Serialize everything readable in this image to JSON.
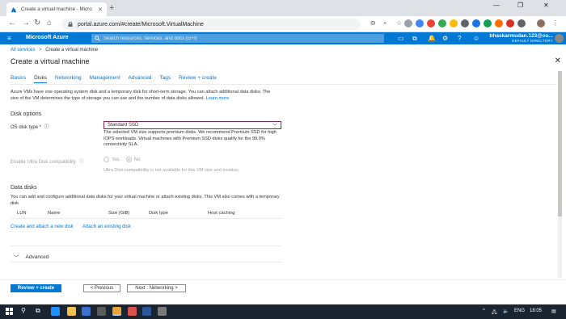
{
  "browser": {
    "tab_title": "Create a virtual machine - Micro",
    "new_tab": "+",
    "url": "portal.azure.com/#create/Microsoft.VirtualMachine",
    "window_controls": [
      "—",
      "❐",
      "✕"
    ]
  },
  "azure_header": {
    "brand": "Microsoft Azure",
    "search_placeholder": "Search resources, services, and docs (G+/)",
    "user_name": "bhaskarmudan.123@ou...",
    "user_directory": "DEFAULT DIRECTORY",
    "accent": "#0078d4"
  },
  "breadcrumb": {
    "root": "All services",
    "sep": ">",
    "current": "Create a virtual machine"
  },
  "page": {
    "title": "Create a virtual machine",
    "close": "✕"
  },
  "tabs": [
    {
      "label": "Basics",
      "active": false
    },
    {
      "label": "Disks",
      "active": true
    },
    {
      "label": "Networking",
      "active": false
    },
    {
      "label": "Management",
      "active": false
    },
    {
      "label": "Advanced",
      "active": false
    },
    {
      "label": "Tags",
      "active": false
    },
    {
      "label": "Review + create",
      "active": false
    }
  ],
  "intro": {
    "text": "Azure VMs have one operating system disk and a temporary disk for short-term storage. You can attach additional data disks. The size of the VM determines the type of storage you can use and the number of data disks allowed.",
    "link": "Learn more"
  },
  "disk_options": {
    "heading": "Disk options",
    "os_disk_label": "OS disk type *",
    "os_disk_value": "Standard SSD",
    "os_disk_note": "The selected VM size supports premium disks. We recommend Premium SSD for high IOPS workloads. Virtual machines with Premium SSD disks qualify for the 99.9% connectivity SLA.",
    "ultra_label": "Enable Ultra Disk compatibility",
    "ultra_yes": "Yes",
    "ultra_no": "No",
    "ultra_note": "Ultra Disk compatibility is not available for this VM size and location."
  },
  "data_disks": {
    "heading": "Data disks",
    "description": "You can add and configure additional data disks for your virtual machine or attach existing disks. This VM also comes with a temporary disk.",
    "columns": [
      "LUN",
      "Name",
      "Size (GiB)",
      "Disk type",
      "Host caching"
    ],
    "create_link": "Create and attach a new disk",
    "attach_link": "Attach an existing disk"
  },
  "advanced": {
    "label": "Advanced"
  },
  "footer": {
    "review_create": "Review + create",
    "previous": "< Previous",
    "next": "Next : Networking >"
  },
  "taskbar": {
    "lang": "ENG",
    "time": "18:05"
  }
}
